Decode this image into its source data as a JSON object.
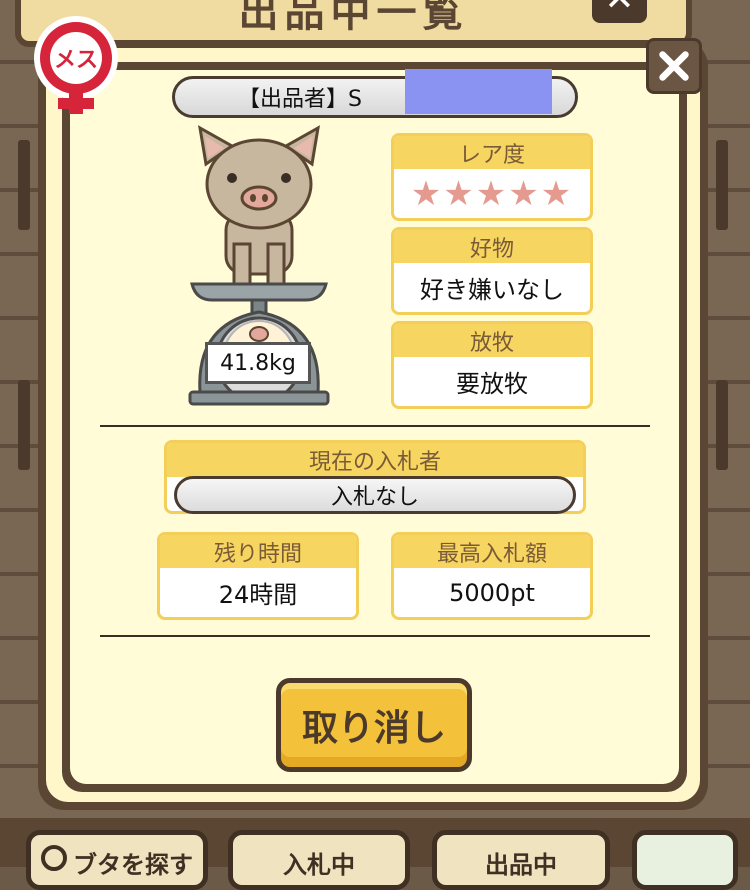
{
  "background": {
    "header_title": "出品中一覧",
    "bottom_tabs": [
      {
        "label": "ブタを探す"
      },
      {
        "label": "入札中"
      },
      {
        "label": "出品中"
      },
      {
        "label": ""
      }
    ]
  },
  "gender_badge": {
    "label": "メス",
    "icon": "female-symbol-icon"
  },
  "seller": {
    "label": "【出品者】S"
  },
  "pig": {
    "weight": "41.8kg"
  },
  "rarity": {
    "title": "レア度",
    "stars": "★★★★★",
    "value": 5
  },
  "favorite": {
    "title": "好物",
    "value": "好き嫌いなし"
  },
  "grazing": {
    "title": "放牧",
    "value": "要放牧"
  },
  "current_bidder": {
    "title": "現在の入札者",
    "value": "入札なし"
  },
  "time_left": {
    "title": "残り時間",
    "value": "24時間"
  },
  "highest_bid": {
    "title": "最高入札額",
    "value": "5000pt"
  },
  "cancel_button": {
    "label": "取り消し"
  },
  "colors": {
    "frame": "#5a4632",
    "card_header": "#f7d561",
    "star": "#e59a8f",
    "button": "#f3c23a",
    "badge_red": "#d6243b"
  }
}
